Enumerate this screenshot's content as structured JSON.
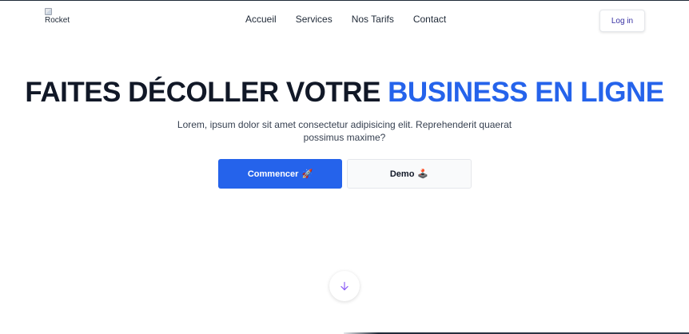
{
  "logo": {
    "alt": "Rocket"
  },
  "nav": {
    "links": [
      "Accueil",
      "Services",
      "Nos Tarifs",
      "Contact"
    ],
    "login_label": "Log in"
  },
  "hero": {
    "title_main": "FAITES DÉCOLLER VOTRE",
    "title_accent": "BUSINESS EN LIGNE",
    "subtitle": "Lorem, ipsum dolor sit amet consectetur adipisicing elit. Reprehenderit quaerat possimus maxime?",
    "primary_label": "Commencer",
    "primary_icon": "🚀",
    "secondary_label": "Demo",
    "secondary_icon": "🕹️"
  },
  "scroll_icon": "arrow-down-icon",
  "colors": {
    "accent": "#2563eb",
    "login_text": "#3730a3",
    "scroll_arrow": "#8b5cf6"
  }
}
